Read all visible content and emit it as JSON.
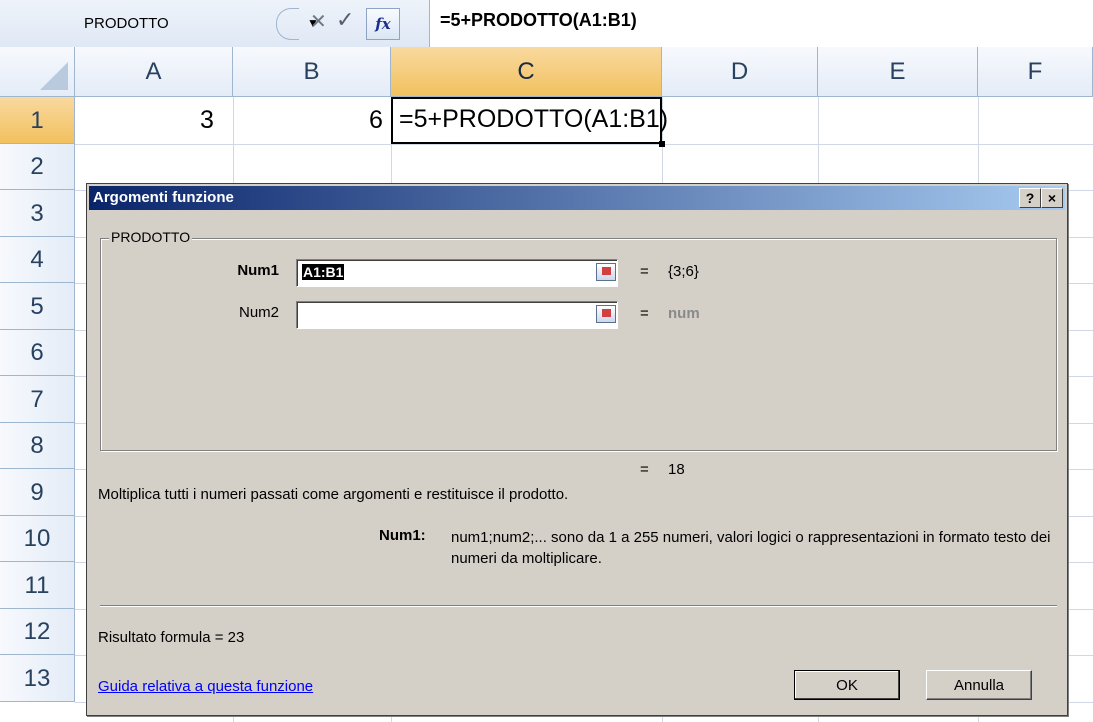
{
  "formula_bar": {
    "name_box": "PRODOTTO",
    "dropdown_arrow": "▼",
    "cancel_glyph": "✕",
    "enter_glyph": "✓",
    "fx_label": "fx",
    "formula": "=5+PRODOTTO(A1:B1)"
  },
  "columns": [
    "A",
    "B",
    "C",
    "D",
    "E",
    "F"
  ],
  "active_column": "C",
  "rows": [
    "1",
    "2",
    "3",
    "4",
    "5",
    "6",
    "7",
    "8",
    "9",
    "10",
    "11",
    "12",
    "13"
  ],
  "active_row": "1",
  "cells": {
    "A1": "3",
    "B1": "6",
    "C1": "=5+PRODOTTO(A1:B1)"
  },
  "dialog": {
    "title": "Argomenti funzione",
    "help_button": "?",
    "close_button": "×",
    "function_name": "PRODOTTO",
    "arguments": [
      {
        "label": "Num1",
        "value": "A1:B1",
        "equals": "=",
        "result": "{3;6}"
      },
      {
        "label": "Num2",
        "value": "",
        "equals": "=",
        "result": "num"
      }
    ],
    "total_equals": "=",
    "total_result": "18",
    "description": "Moltiplica tutti i numeri passati come argomenti e restituisce il prodotto.",
    "arg_help_label": "Num1:",
    "arg_help_text": "num1;num2;... sono da 1 a 255 numeri, valori logici o rappresentazioni in formato testo dei numeri da moltiplicare.",
    "result_formula": "Risultato formula =  23",
    "help_link": "Guida relativa a questa funzione",
    "ok_label": "OK",
    "cancel_label": "Annulla"
  },
  "icons": {
    "fx": "function-icon",
    "ref": "range-select-icon",
    "cancel": "cancel-icon",
    "enter": "check-icon"
  },
  "colors": {
    "title_bar": "#0a246a",
    "dialog_bg": "#d4d0c8",
    "header_active": "#f1c15f",
    "link": "#0000ff"
  }
}
